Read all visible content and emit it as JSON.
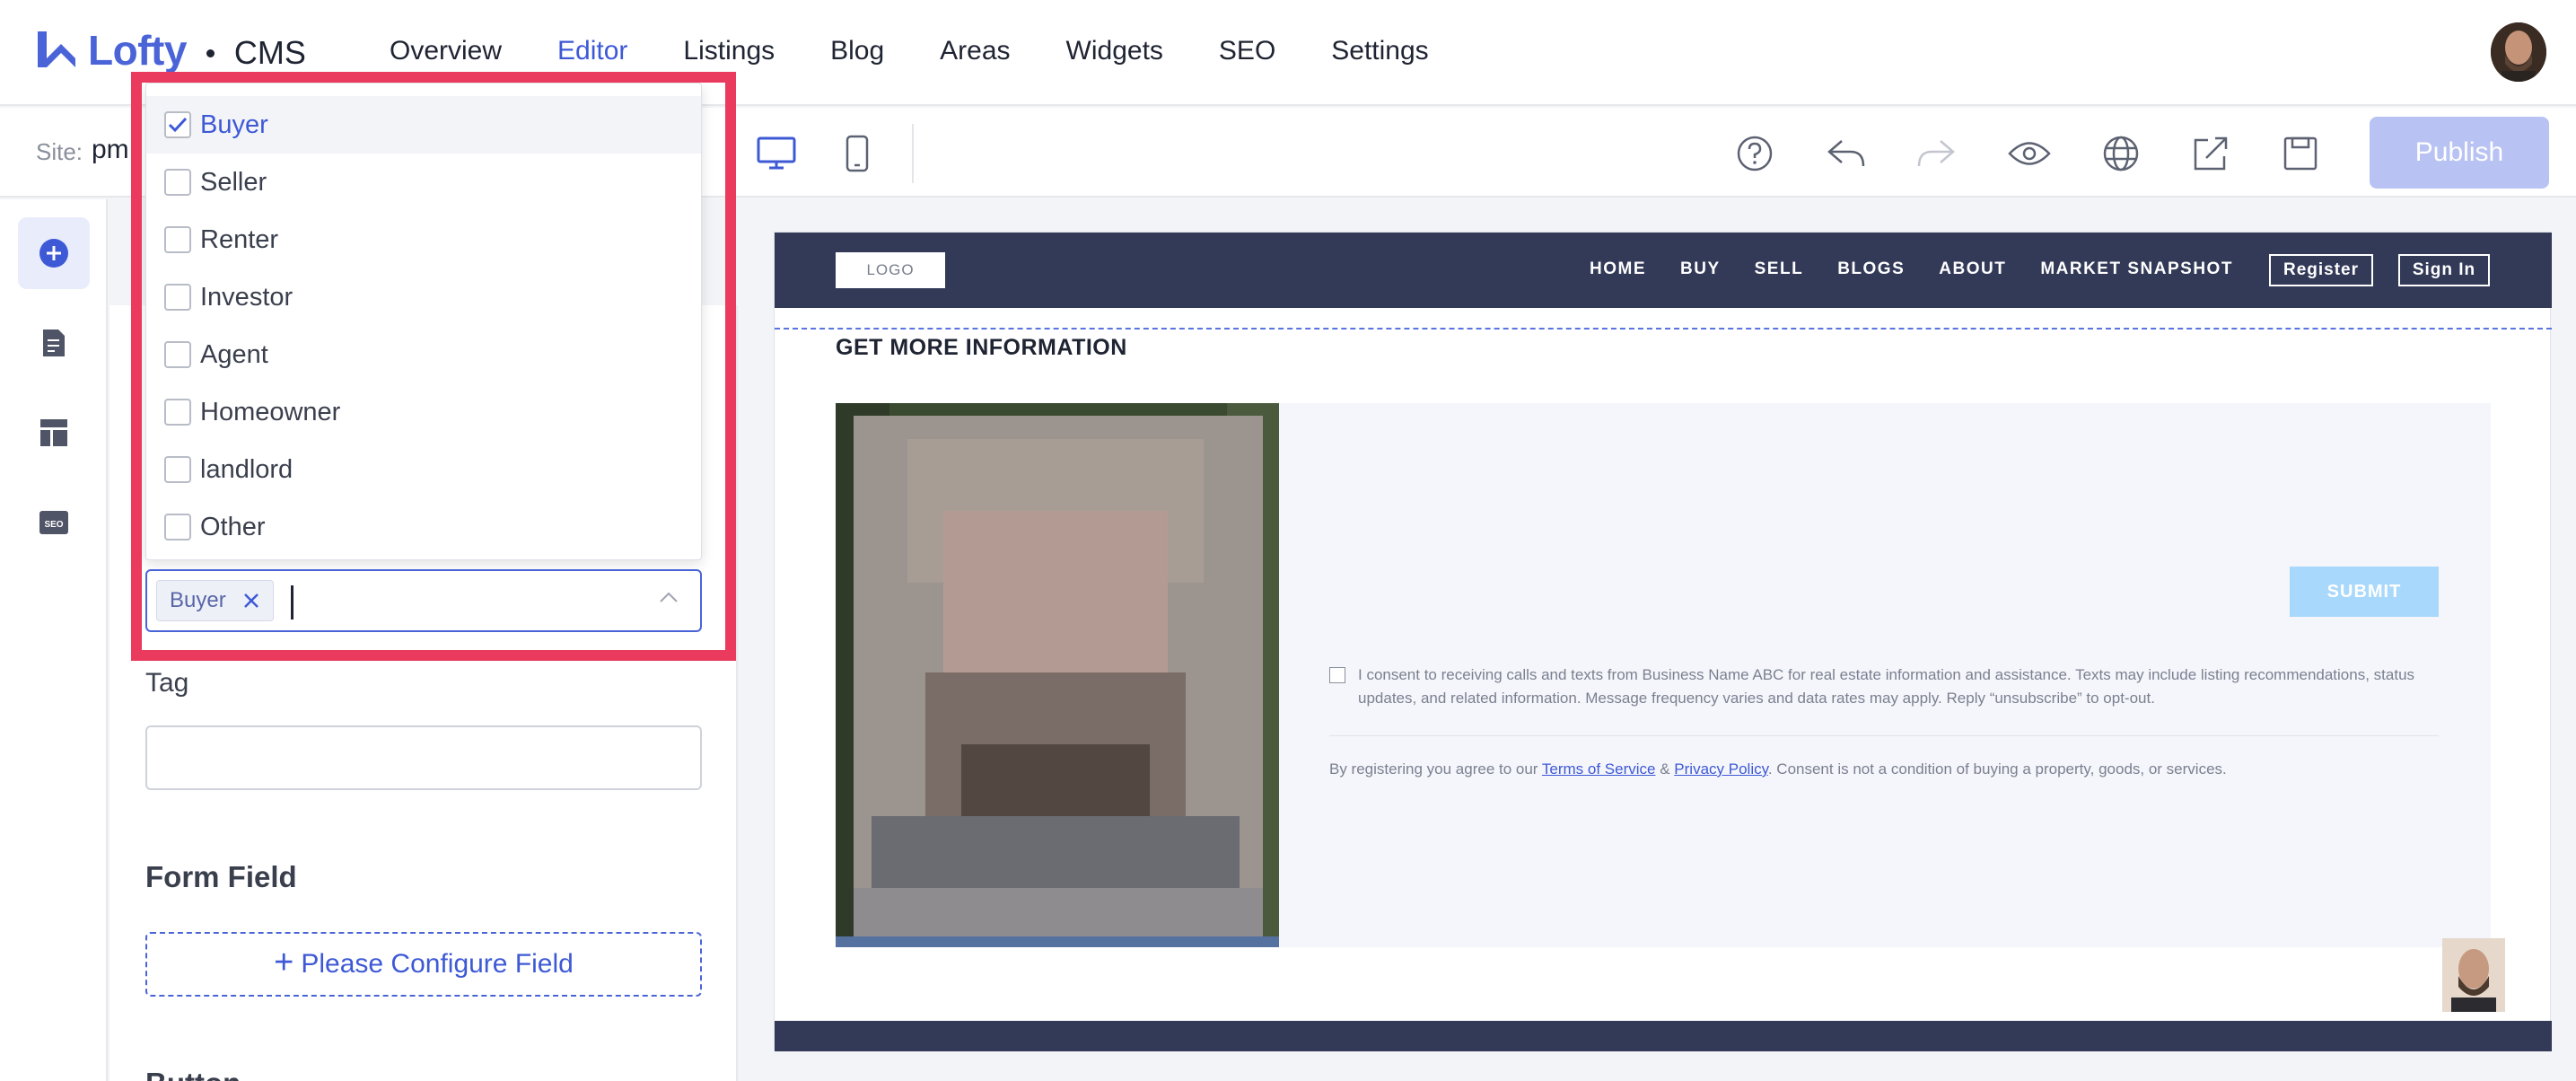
{
  "brand": {
    "name": "Lofty",
    "product": "CMS",
    "accent": "#4a64d8"
  },
  "nav": {
    "items": [
      {
        "label": "Overview"
      },
      {
        "label": "Editor"
      },
      {
        "label": "Listings"
      },
      {
        "label": "Blog"
      },
      {
        "label": "Areas"
      },
      {
        "label": "Widgets"
      },
      {
        "label": "SEO"
      },
      {
        "label": "Settings"
      }
    ],
    "active": "Editor"
  },
  "toolbar": {
    "site_label": "Site:",
    "site_value": "pm",
    "publish_label": "Publish",
    "icons": [
      "desktop-icon",
      "mobile-icon",
      "help-icon",
      "undo-icon",
      "redo-icon",
      "preview-icon",
      "globe-icon",
      "export-icon",
      "save-icon"
    ]
  },
  "rail": {
    "icons": [
      "add-circle-icon",
      "page-icon",
      "layout-icon",
      "seo-icon"
    ],
    "seo_text": "SEO"
  },
  "panel": {
    "tag_label": "Tag",
    "tag_value": "",
    "form_field_label": "Form Field",
    "configure_label": "Please Configure Field",
    "button_label": "Button"
  },
  "dropdown": {
    "options": [
      {
        "label": "Buyer",
        "checked": true
      },
      {
        "label": "Seller",
        "checked": false
      },
      {
        "label": "Renter",
        "checked": false
      },
      {
        "label": "Investor",
        "checked": false
      },
      {
        "label": "Agent",
        "checked": false
      },
      {
        "label": "Homeowner",
        "checked": false
      },
      {
        "label": "landlord",
        "checked": false
      },
      {
        "label": "Other",
        "checked": false
      }
    ],
    "selected_chip": "Buyer",
    "highlight_color": "#ea3a5e"
  },
  "preview": {
    "logo": "LOGO",
    "nav": [
      "HOME",
      "BUY",
      "SELL",
      "BLOGS",
      "ABOUT",
      "MARKET SNAPSHOT"
    ],
    "register": "Register",
    "sign_in": "Sign In",
    "section_title": "GET MORE INFORMATION",
    "submit": "SUBMIT",
    "consent": "I consent to receiving calls and texts from Business Name ABC for real estate information and assistance. Texts may include listing recommendations, status updates, and related information. Message frequency varies and data rates may apply. Reply “unsubscribe” to opt-out.",
    "register_prefix": "By registering you agree to our",
    "terms": "Terms of Service",
    "amp": "&",
    "privacy": "Privacy Policy",
    "register_suffix": ". Consent is not a condition of buying a property, goods, or services.",
    "header_color": "#333a58",
    "submit_color": "#a8d8fb"
  }
}
